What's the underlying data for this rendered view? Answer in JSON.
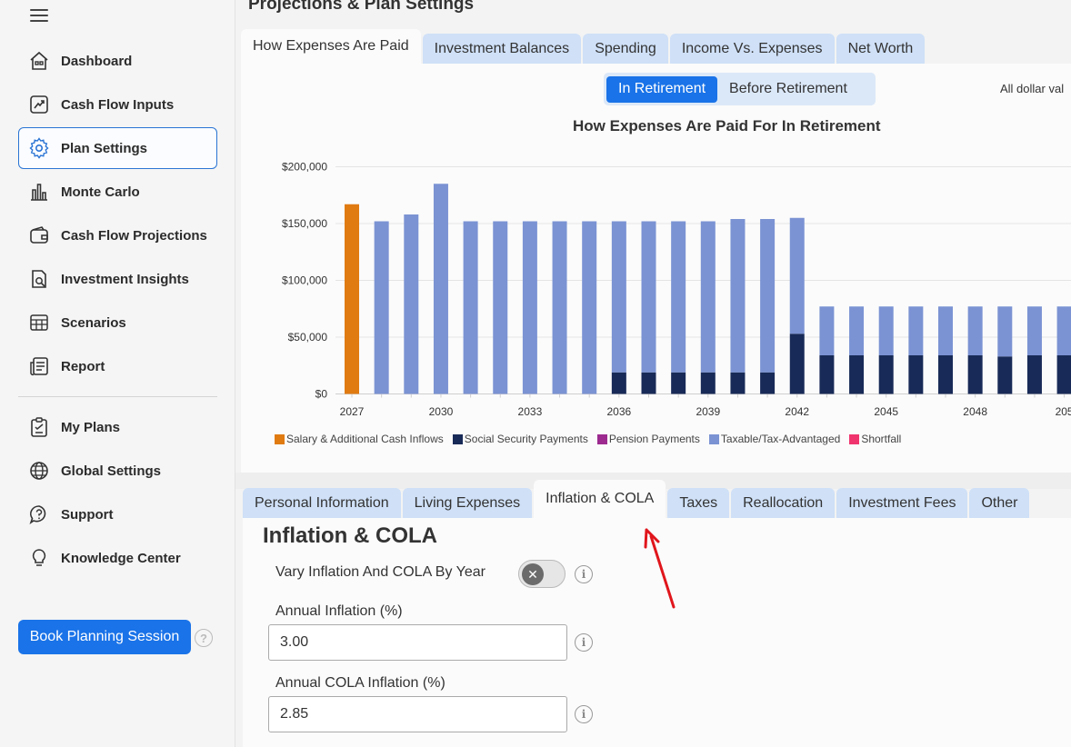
{
  "sidebar": {
    "items": [
      {
        "label": "Dashboard"
      },
      {
        "label": "Cash Flow Inputs"
      },
      {
        "label": "Plan Settings"
      },
      {
        "label": "Monte Carlo"
      },
      {
        "label": "Cash Flow Projections"
      },
      {
        "label": "Investment Insights"
      },
      {
        "label": "Scenarios"
      },
      {
        "label": "Report"
      },
      {
        "label": "My Plans"
      },
      {
        "label": "Global Settings"
      },
      {
        "label": "Support"
      },
      {
        "label": "Knowledge Center"
      }
    ],
    "book_button": "Book Planning Session"
  },
  "page_title": "Projections & Plan Settings",
  "chart_tabs": [
    "How Expenses Are Paid",
    "Investment Balances",
    "Spending",
    "Income Vs. Expenses",
    "Net Worth"
  ],
  "toggle": {
    "on": "In Retirement",
    "off": "Before Retirement"
  },
  "note": "All dollar val",
  "chart_data": {
    "type": "bar",
    "title": "How Expenses Are Paid For In Retirement",
    "stacked": true,
    "categories": [
      "2027",
      "2028",
      "2029",
      "2030",
      "2031",
      "2032",
      "2033",
      "2034",
      "2035",
      "2036",
      "2037",
      "2038",
      "2039",
      "2040",
      "2041",
      "2042",
      "2043",
      "2044",
      "2045",
      "2046",
      "2047",
      "2048",
      "2049",
      "2050",
      "2051"
    ],
    "x_tick_labels": [
      "2027",
      "2030",
      "2033",
      "2036",
      "2039",
      "2042",
      "2045",
      "2048",
      "205"
    ],
    "y_tick_labels": [
      "$0",
      "$50,000",
      "$100,000",
      "$150,000",
      "$200,000"
    ],
    "ylim": [
      0,
      200000
    ],
    "series": [
      {
        "name": "Salary & Additional Cash Inflows",
        "color": "#e07b12",
        "values": [
          167000,
          0,
          0,
          0,
          0,
          0,
          0,
          0,
          0,
          0,
          0,
          0,
          0,
          0,
          0,
          0,
          0,
          0,
          0,
          0,
          0,
          0,
          0,
          0,
          0
        ]
      },
      {
        "name": "Social Security Payments",
        "color": "#182a57",
        "values": [
          0,
          0,
          0,
          0,
          0,
          0,
          0,
          0,
          0,
          19000,
          19000,
          19000,
          19000,
          19000,
          19000,
          53000,
          34000,
          34000,
          34000,
          34000,
          34000,
          34000,
          33000,
          34000,
          34000
        ]
      },
      {
        "name": "Pension Payments",
        "color": "#9c2a8f",
        "values": [
          0,
          0,
          0,
          0,
          0,
          0,
          0,
          0,
          0,
          0,
          0,
          0,
          0,
          0,
          0,
          0,
          0,
          0,
          0,
          0,
          0,
          0,
          0,
          0,
          0
        ]
      },
      {
        "name": "Taxable/Tax-Advantaged",
        "color": "#7b93d3",
        "values": [
          0,
          152000,
          158000,
          185000,
          152000,
          152000,
          152000,
          152000,
          152000,
          133000,
          133000,
          133000,
          133000,
          135000,
          135000,
          102000,
          43000,
          43000,
          43000,
          43000,
          43000,
          43000,
          44000,
          43000,
          43000
        ]
      },
      {
        "name": "Shortfall",
        "color": "#f0346e",
        "values": [
          0,
          0,
          0,
          0,
          0,
          0,
          0,
          0,
          0,
          0,
          0,
          0,
          0,
          0,
          0,
          0,
          0,
          0,
          0,
          0,
          0,
          0,
          0,
          0,
          0
        ]
      }
    ]
  },
  "settings_tabs": [
    "Personal Information",
    "Living Expenses",
    "Inflation & COLA",
    "Taxes",
    "Reallocation",
    "Investment Fees",
    "Other"
  ],
  "inflation": {
    "title": "Inflation & COLA",
    "vary_label": "Vary Inflation And COLA By Year",
    "annual_inflation_label": "Annual Inflation (%)",
    "annual_inflation_value": "3.00",
    "cola_label": "Annual COLA Inflation (%)",
    "cola_value": "2.85"
  }
}
